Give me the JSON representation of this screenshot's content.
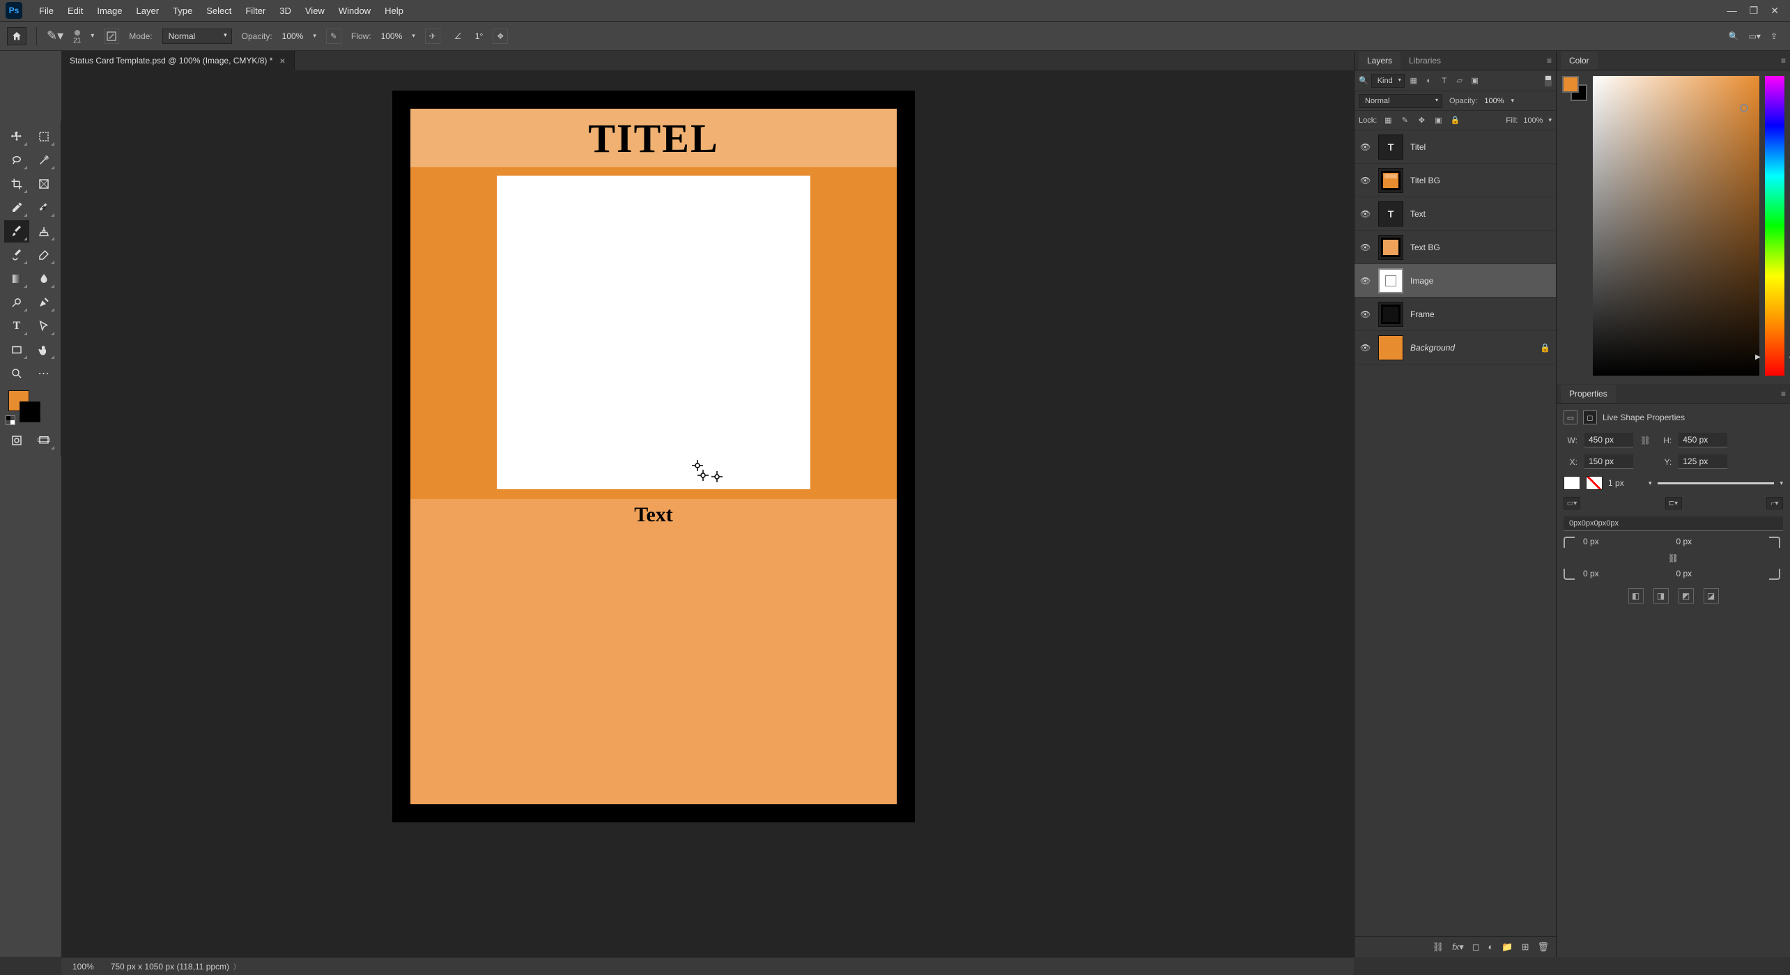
{
  "app": {
    "logo_text": "Ps"
  },
  "menu": [
    "File",
    "Edit",
    "Image",
    "Layer",
    "Type",
    "Select",
    "Filter",
    "3D",
    "View",
    "Window",
    "Help"
  ],
  "options": {
    "brush_size": "21",
    "mode_label": "Mode:",
    "mode_value": "Normal",
    "opacity_label": "Opacity:",
    "opacity_value": "100%",
    "flow_label": "Flow:",
    "flow_value": "100%",
    "smoothing_prefix": "∠",
    "smoothing_value": "1°"
  },
  "tab": {
    "title": "Status Card Template.psd @ 100% (Image, CMYK/8) *"
  },
  "canvas_text": {
    "title": "TITEL",
    "body": "Text"
  },
  "status": {
    "zoom": "100%",
    "doc": "750 px x 1050 px (118,11 ppcm)"
  },
  "layers_panel": {
    "tabs": [
      "Layers",
      "Libraries"
    ],
    "filter_dropdown": "Kind",
    "blend_mode": "Normal",
    "opacity_label": "Opacity:",
    "opacity_value": "100%",
    "lock_label": "Lock:",
    "fill_label": "Fill:",
    "fill_value": "100%",
    "layers": [
      {
        "name": "Titel",
        "kind": "text"
      },
      {
        "name": "Titel BG",
        "kind": "shape"
      },
      {
        "name": "Text",
        "kind": "text"
      },
      {
        "name": "Text BG",
        "kind": "shape"
      },
      {
        "name": "Image",
        "kind": "shape",
        "selected": true
      },
      {
        "name": "Frame",
        "kind": "shape"
      },
      {
        "name": "Background",
        "kind": "bg",
        "locked": true
      }
    ]
  },
  "color_panel": {
    "tab": "Color"
  },
  "properties_panel": {
    "tab": "Properties",
    "header": "Live Shape Properties",
    "W_label": "W:",
    "W": "450 px",
    "H_label": "H:",
    "H": "450 px",
    "X_label": "X:",
    "X": "150 px",
    "Y_label": "Y:",
    "Y": "125 px",
    "stroke_width": "1 px",
    "corners_combined": "0px0px0px0px",
    "corner_tl": "0 px",
    "corner_tr": "0 px",
    "corner_bl": "0 px",
    "corner_br": "0 px"
  }
}
